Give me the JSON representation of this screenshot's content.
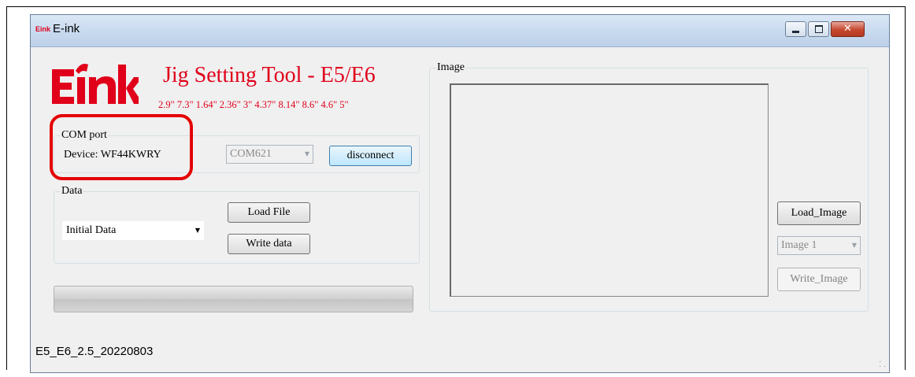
{
  "window": {
    "title": "E-ink",
    "icon_text": "Eink",
    "controls": {
      "minimize": "minimize",
      "maximize": "maximize",
      "close": "✕"
    }
  },
  "header": {
    "logo_text": "Eink",
    "app_title": "Jig Setting Tool - E5/E6",
    "sizes": "2.9\" 7.3\" 1.64\" 2.36\" 3\" 4.37\" 8.14\" 8.6\" 4.6\" 5\""
  },
  "com_port": {
    "legend": "COM port",
    "device_label": "Device: WF44KWRY",
    "port_value": "COM621",
    "disconnect_label": "disconnect"
  },
  "data_group": {
    "legend": "Data",
    "selected": "Initial Data",
    "load_file_label": "Load File",
    "write_data_label": "Write data"
  },
  "progress": {
    "value": 0
  },
  "image_group": {
    "legend": "Image",
    "load_image_label": "Load_Image",
    "image_select": "Image 1",
    "write_image_label": "Write_Image"
  },
  "status": {
    "version": "E5_E6_2.5_20220803"
  },
  "colors": {
    "brand_red": "#e0001a",
    "annotation_red": "#e50000",
    "titlebar": "#c9dbef",
    "window_bg": "#f0f0f0"
  }
}
